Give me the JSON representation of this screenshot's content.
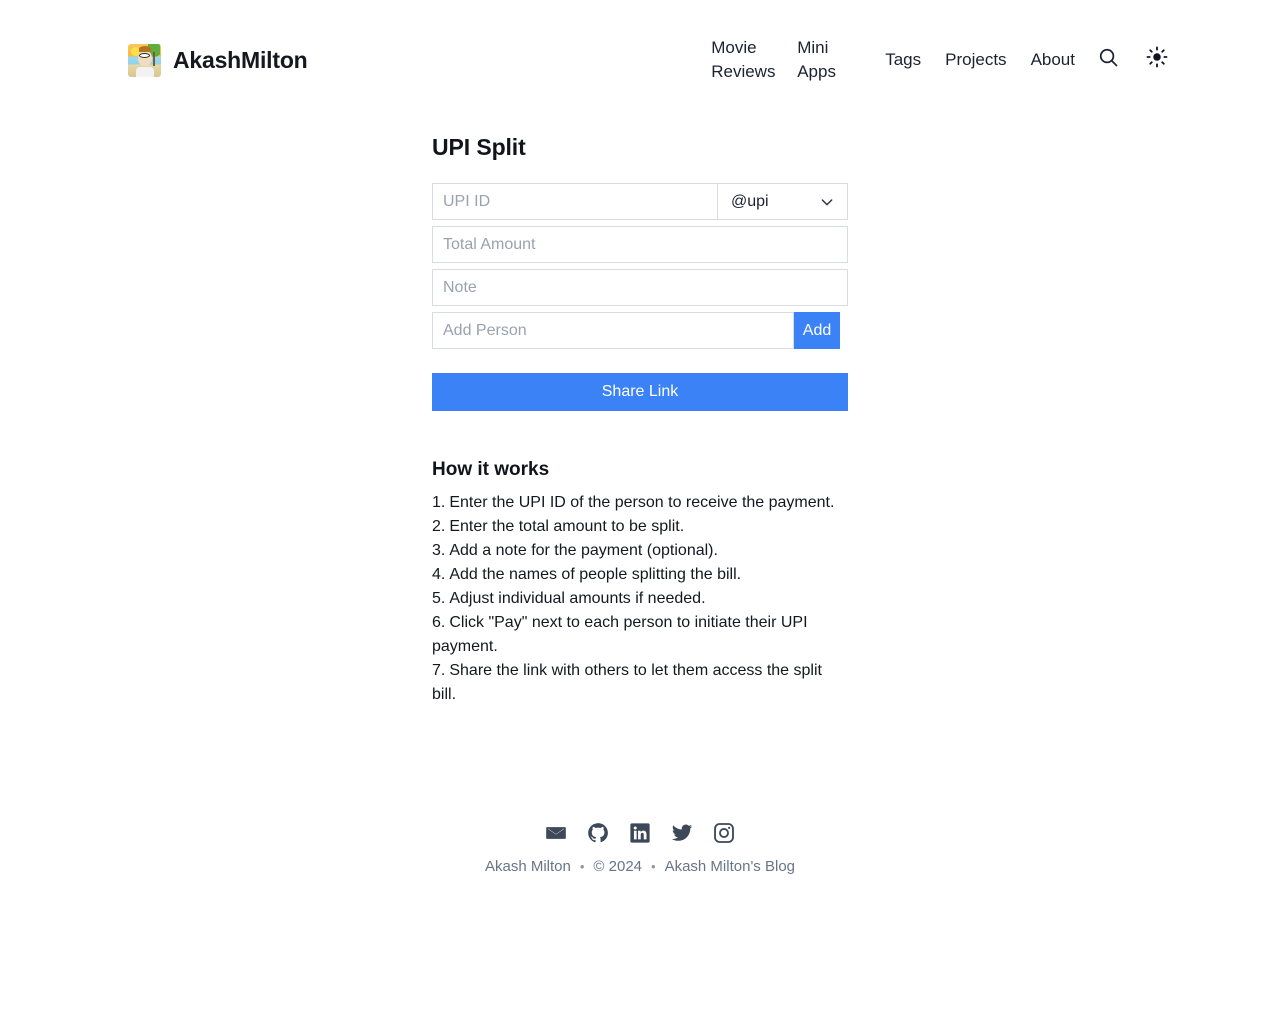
{
  "header": {
    "brand_name": "AkashMilton",
    "avatar_icon": "avatar-image",
    "nav": [
      {
        "label": "Movie\nReviews",
        "name": "movie-reviews"
      },
      {
        "label": "Mini\nApps",
        "name": "mini-apps"
      },
      {
        "label": "Tags",
        "name": "tags"
      },
      {
        "label": "Projects",
        "name": "projects"
      },
      {
        "label": "About",
        "name": "about"
      }
    ],
    "search_icon": "search-icon",
    "theme_icon": "sun-icon"
  },
  "main": {
    "title": "UPI Split",
    "upi_id": {
      "placeholder": "UPI ID",
      "value": ""
    },
    "upi_suffix": {
      "selected": "@upi",
      "chevron_icon": "chevron-down-icon"
    },
    "total_amount": {
      "placeholder": "Total Amount",
      "value": ""
    },
    "note": {
      "placeholder": "Note",
      "value": ""
    },
    "add_person": {
      "placeholder": "Add Person",
      "value": ""
    },
    "add_button": "Add",
    "share_button": "Share Link",
    "how_it_works": {
      "title": "How it works",
      "steps": [
        {
          "num": "1.",
          "text": "Enter the UPI ID of the person to receive the payment."
        },
        {
          "num": "2.",
          "text": "Enter the total amount to be split."
        },
        {
          "num": "3.",
          "text": "Add a note for the payment (optional)."
        },
        {
          "num": "4.",
          "text": "Add the names of people splitting the bill."
        },
        {
          "num": "5.",
          "text": "Adjust individual amounts if needed."
        },
        {
          "num": "6.",
          "text": "Click \"Pay\" next to each person to initiate their UPI payment."
        },
        {
          "num": "7.",
          "text": "Share the link with others to let them access the split bill."
        }
      ]
    }
  },
  "footer": {
    "socials": [
      {
        "name": "email-icon",
        "label": "Email"
      },
      {
        "name": "github-icon",
        "label": "GitHub"
      },
      {
        "name": "linkedin-icon",
        "label": "LinkedIn"
      },
      {
        "name": "twitter-icon",
        "label": "Twitter"
      },
      {
        "name": "instagram-icon",
        "label": "Instagram"
      }
    ],
    "author": "Akash Milton",
    "separator": "•",
    "copyright": "© 2024",
    "blog": "Akash Milton's Blog"
  },
  "colors": {
    "accent_blue": "#3b82f6",
    "text_dark": "#15181f",
    "text_muted": "#687588",
    "placeholder": "#9aa2ae",
    "border": "#d8dce2",
    "background": "#ffffff"
  }
}
